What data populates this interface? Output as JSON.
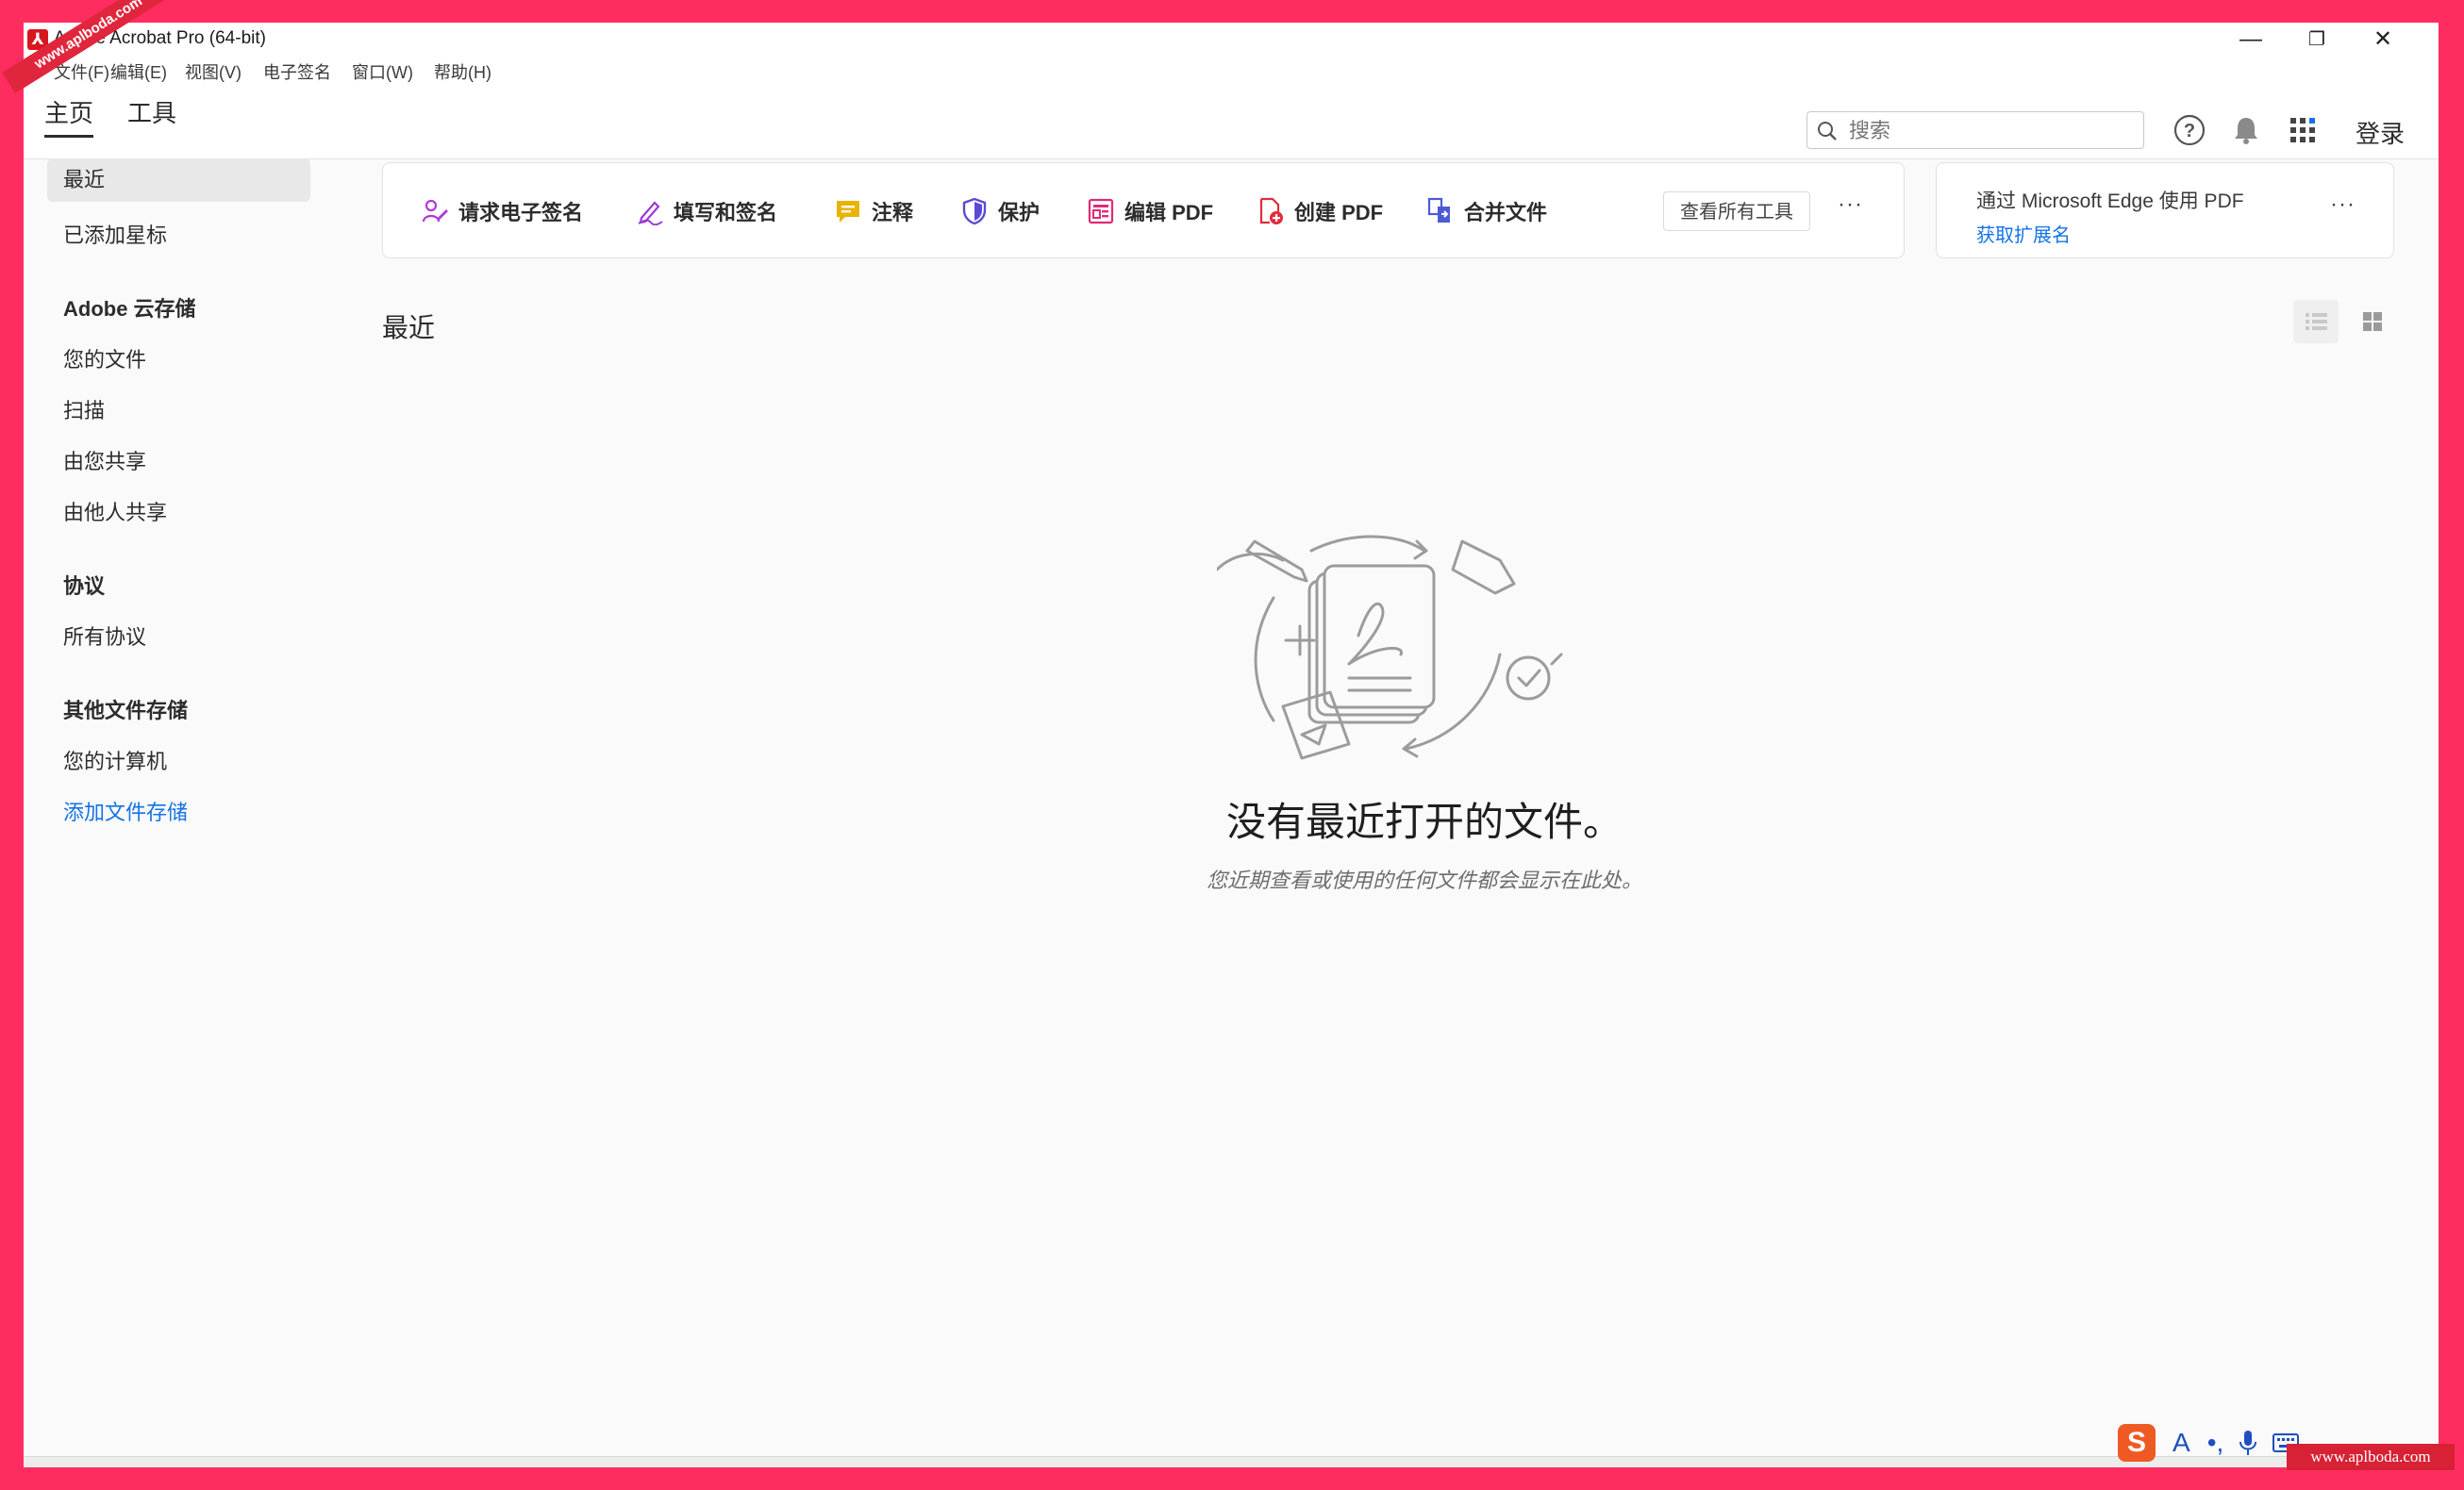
{
  "titlebar": {
    "title": "Adobe Acrobat Pro (64-bit)",
    "minimize": "—",
    "restore": "❐",
    "close": "✕"
  },
  "menubar": {
    "items": [
      "文件(F)",
      "编辑(E)",
      "视图(V)",
      "电子签名",
      "窗口(W)",
      "帮助(H)"
    ]
  },
  "tabs": {
    "home": "主页",
    "tools": "工具"
  },
  "header": {
    "search_placeholder": "搜索",
    "login": "登录"
  },
  "sidebar": {
    "recent": "最近",
    "starred": "已添加星标",
    "cloud_heading": "Adobe 云存储",
    "your_files": "您的文件",
    "scan": "扫描",
    "shared_by_you": "由您共享",
    "shared_by_others": "由他人共享",
    "agreements_heading": "协议",
    "all_agreements": "所有协议",
    "other_storage_heading": "其他文件存储",
    "your_computer": "您的计算机",
    "add_storage": "添加文件存储"
  },
  "toolbar": {
    "tools": [
      {
        "label": "请求电子签名",
        "icon": "request-signature-icon",
        "color": "#b03ad6"
      },
      {
        "label": "填写和签名",
        "icon": "fill-sign-icon",
        "color": "#9c3ad6"
      },
      {
        "label": "注释",
        "icon": "comment-icon",
        "color": "#e8b400"
      },
      {
        "label": "保护",
        "icon": "protect-icon",
        "color": "#5a4bd6"
      },
      {
        "label": "编辑 PDF",
        "icon": "edit-pdf-icon",
        "color": "#e0297a"
      },
      {
        "label": "创建 PDF",
        "icon": "create-pdf-icon",
        "color": "#e02d3c"
      },
      {
        "label": "合并文件",
        "icon": "combine-files-icon",
        "color": "#4b5bd6"
      }
    ],
    "view_all": "查看所有工具",
    "more": "···"
  },
  "edge_card": {
    "title": "通过 Microsoft Edge 使用 PDF",
    "link": "获取扩展名",
    "more": "···"
  },
  "recent": {
    "title": "最近",
    "empty_title": "没有最近打开的文件。",
    "empty_subtitle": "您近期查看或使用的任何文件都会显示在此处。"
  },
  "tray": {
    "ime_logo": "S",
    "ime_mode": "A"
  },
  "watermarks": {
    "corner": "www.aplboda.com",
    "bottom": "www.aplboda.com"
  }
}
